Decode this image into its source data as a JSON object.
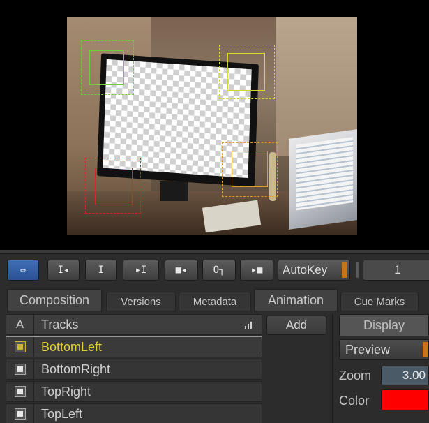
{
  "toolbar": {
    "autokey_label": "AutoKey",
    "frame_value": "1",
    "buttons": [
      {
        "name": "link-toggle-button",
        "glyph": "⇔"
      },
      {
        "name": "go-to-start-button",
        "glyph": "I◂"
      },
      {
        "name": "set-in-button",
        "glyph": "I"
      },
      {
        "name": "go-to-end-button",
        "glyph": "▸I"
      },
      {
        "name": "prev-key-button",
        "glyph": "■◂"
      },
      {
        "name": "key-button",
        "glyph": "O┐"
      },
      {
        "name": "next-key-button",
        "glyph": "▸■"
      }
    ]
  },
  "tabs": [
    "Composition",
    "Versions",
    "Metadata",
    "Animation",
    "Cue Marks"
  ],
  "tracks": {
    "header_a": "A",
    "header_title": "Tracks",
    "rows": [
      {
        "name": "BottomLeft",
        "selected": true
      },
      {
        "name": "BottomRight",
        "selected": false
      },
      {
        "name": "TopRight",
        "selected": false
      },
      {
        "name": "TopLeft",
        "selected": false
      }
    ]
  },
  "add_label": "Add",
  "display": {
    "label": "Display",
    "preview_value": "Preview",
    "zoom_label": "Zoom",
    "zoom_value": "3.00",
    "color_label": "Color",
    "color_value": "#ff0000"
  },
  "trackers": [
    {
      "name": "tracker-top-left",
      "color": "#6fcf3a"
    },
    {
      "name": "tracker-top-right",
      "color": "#d8d428"
    },
    {
      "name": "tracker-bottom-left",
      "color": "#e02424"
    },
    {
      "name": "tracker-bottom-right",
      "color": "#e29a2a"
    }
  ]
}
